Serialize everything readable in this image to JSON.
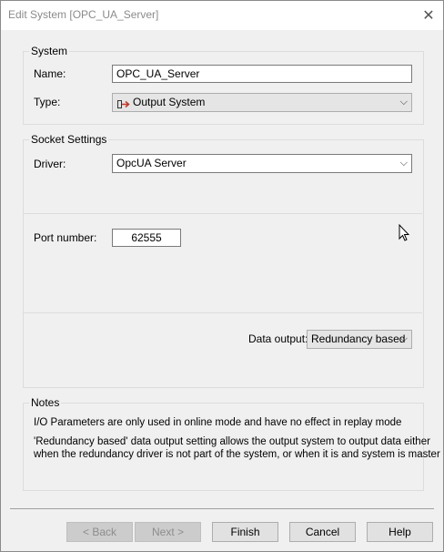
{
  "window": {
    "title": "Edit System [OPC_UA_Server]"
  },
  "system_group": {
    "label": "System",
    "name_label": "Name:",
    "name_value": "OPC_UA_Server",
    "type_label": "Type:",
    "type_value": "Output System",
    "type_icon": "output-system-icon"
  },
  "socket_group": {
    "label": "Socket Settings",
    "driver_label": "Driver:",
    "driver_value": "OpcUA Server",
    "port_label": "Port number:",
    "port_value": "62555",
    "data_output_label": "Data output:",
    "data_output_value": "Redundancy based"
  },
  "notes_group": {
    "label": "Notes",
    "line1": "I/O Parameters are only used in online mode and have no effect in replay mode",
    "line2": "'Redundancy based' data output setting allows the output system to output data either",
    "line3": "when the redundancy driver is not part of the system, or when it is and system is master"
  },
  "buttons": {
    "back": "< Back",
    "next": "Next >",
    "finish": "Finish",
    "cancel": "Cancel",
    "help": "Help"
  },
  "colors": {
    "icon_red": "#c0392b"
  }
}
